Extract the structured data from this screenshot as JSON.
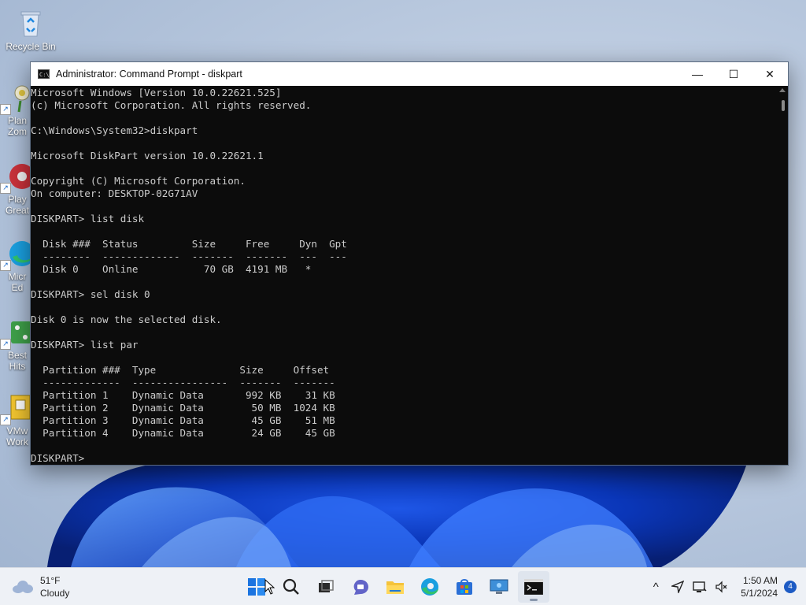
{
  "desktop": {
    "icons": [
      {
        "label": "Recycle Bin"
      },
      {
        "label": "Plan\nZom"
      },
      {
        "label": "Play\nGreat"
      },
      {
        "label": "Micr\nEd"
      },
      {
        "label": "Best\nHits"
      },
      {
        "label": "VMw\nWork"
      }
    ]
  },
  "window": {
    "title": "Administrator: Command Prompt - diskpart",
    "icon_text": "C:\\",
    "minimize_glyph": "—",
    "maximize_glyph": "☐",
    "close_glyph": "✕"
  },
  "console": {
    "text": "Microsoft Windows [Version 10.0.22621.525]\n(c) Microsoft Corporation. All rights reserved.\n\nC:\\Windows\\System32>diskpart\n\nMicrosoft DiskPart version 10.0.22621.1\n\nCopyright (C) Microsoft Corporation.\nOn computer: DESKTOP-02G71AV\n\nDISKPART> list disk\n\n  Disk ###  Status         Size     Free     Dyn  Gpt\n  --------  -------------  -------  -------  ---  ---\n  Disk 0    Online           70 GB  4191 MB   *\n\nDISKPART> sel disk 0\n\nDisk 0 is now the selected disk.\n\nDISKPART> list par\n\n  Partition ###  Type              Size     Offset\n  -------------  ----------------  -------  -------\n  Partition 1    Dynamic Data       992 KB    31 KB\n  Partition 2    Dynamic Data        50 MB  1024 KB\n  Partition 3    Dynamic Data        45 GB    51 MB\n  Partition 4    Dynamic Data        24 GB    45 GB\n\nDISKPART> "
  },
  "taskbar": {
    "weather_temp": "51°F",
    "weather_desc": "Cloudy",
    "apps": [
      "start",
      "search",
      "task-view",
      "teams-chat",
      "file-explorer",
      "edge",
      "store",
      "remote-desktop",
      "command-prompt"
    ],
    "tray_overflow_glyph": "^",
    "time": "1:50 AM",
    "date": "5/1/2024",
    "notification_count": "4"
  },
  "colors": {
    "console_bg": "#0c0c0c",
    "console_fg": "#cccccc",
    "taskbar_bg": "#eef1f6",
    "accent": "#1d5bc4"
  }
}
